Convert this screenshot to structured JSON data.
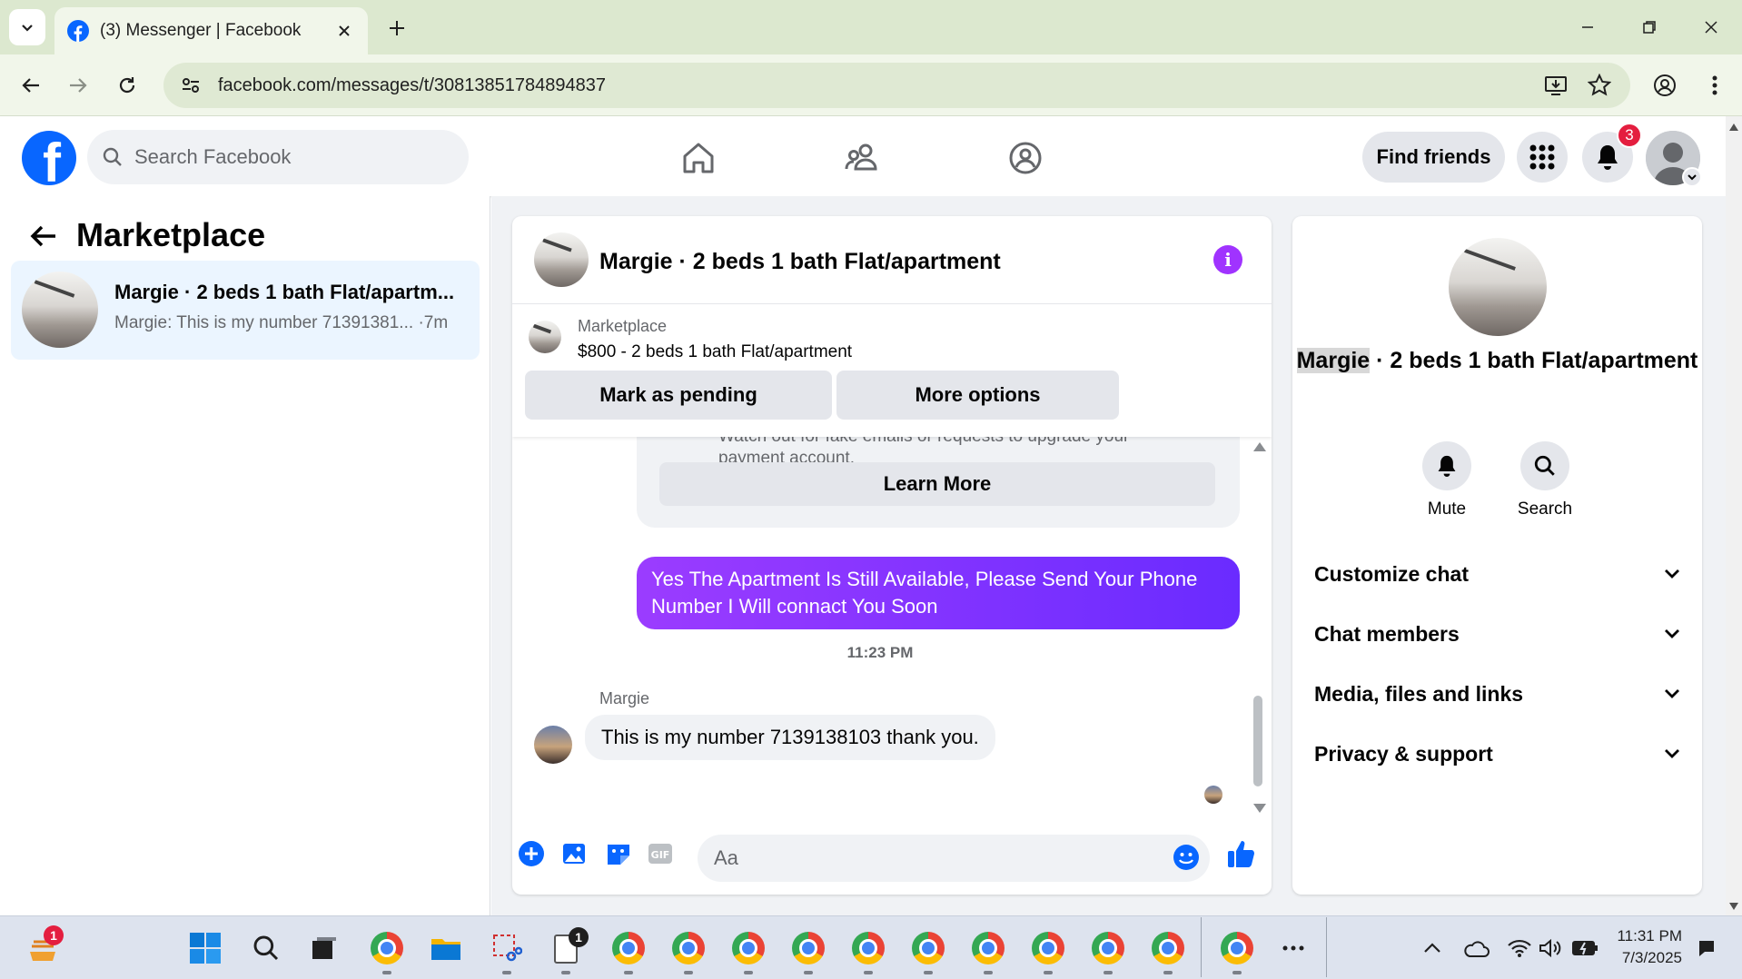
{
  "browser": {
    "tab_title": "(3) Messenger | Facebook",
    "url": "facebook.com/messages/t/30813851784894837"
  },
  "fb_header": {
    "search_placeholder": "Search Facebook",
    "find_friends_label": "Find friends",
    "notification_count": "3"
  },
  "left_panel": {
    "title": "Marketplace",
    "conversations": [
      {
        "title": "Margie · 2 beds 1 bath Flat/apartm...",
        "preview": "Margie: This is my number 71391381...",
        "time": "·7m"
      }
    ]
  },
  "chat": {
    "header_title": "Margie · 2 beds 1 bath Flat/apartment",
    "listing": {
      "label": "Marketplace",
      "price_title": "$800 - 2 beds 1 bath Flat/apartment",
      "mark_pending_label": "Mark as pending",
      "more_options_label": "More options"
    },
    "warning_text": "Watch out for fake emails or requests to upgrade your payment account.",
    "learn_more_label": "Learn More",
    "sent_message": "Yes The Apartment Is Still Available, Please Send Your Phone Number I Will connact You Soon",
    "timestamp": "11:23 PM",
    "sender_name": "Margie",
    "received_message": "This is my number 7139138103 thank you.",
    "composer_placeholder": "Aa"
  },
  "right_panel": {
    "title_highlight": "Margie",
    "title_rest": " · 2 beds 1 bath Flat/apartment",
    "actions": [
      {
        "label": "Mute",
        "icon": "bell-icon"
      },
      {
        "label": "Search",
        "icon": "search-icon"
      }
    ],
    "sections": [
      {
        "label": "Customize chat"
      },
      {
        "label": "Chat members"
      },
      {
        "label": "Media, files and links"
      },
      {
        "label": "Privacy & support"
      }
    ]
  },
  "taskbar": {
    "widget_badge": "1",
    "notepad_badge": "1",
    "time": "11:31 PM",
    "date": "7/3/2025"
  },
  "colors": {
    "fb_blue": "#0866ff",
    "sent_bubble": "#7b2fff",
    "info_purple": "#a033ff",
    "badge_red": "#e41e3f"
  }
}
